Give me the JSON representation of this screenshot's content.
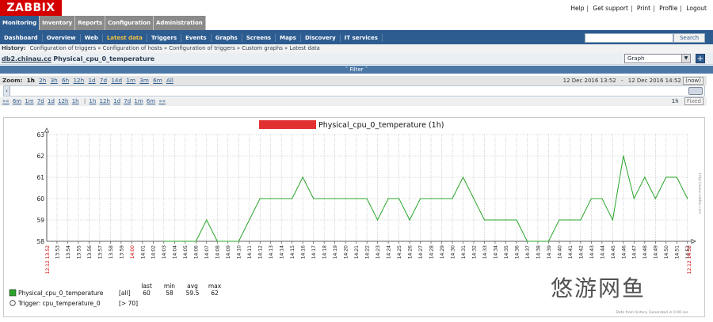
{
  "header": {
    "logo": "ZABBIX",
    "links": [
      "Help",
      "Get support",
      "Print",
      "Profile",
      "Logout"
    ]
  },
  "tabs": [
    {
      "label": "Monitoring",
      "active": true
    },
    {
      "label": "Inventory",
      "active": false
    },
    {
      "label": "Reports",
      "active": false
    },
    {
      "label": "Configuration",
      "active": false
    },
    {
      "label": "Administration",
      "active": false
    }
  ],
  "subnav": [
    {
      "label": "Dashboard",
      "active": false
    },
    {
      "label": "Overview",
      "active": false
    },
    {
      "label": "Web",
      "active": false
    },
    {
      "label": "Latest data",
      "active": true
    },
    {
      "label": "Triggers",
      "active": false
    },
    {
      "label": "Events",
      "active": false
    },
    {
      "label": "Graphs",
      "active": false
    },
    {
      "label": "Screens",
      "active": false
    },
    {
      "label": "Maps",
      "active": false
    },
    {
      "label": "Discovery",
      "active": false
    },
    {
      "label": "IT services",
      "active": false
    }
  ],
  "search": {
    "placeholder": "",
    "button": "Search"
  },
  "history": {
    "label": "History:",
    "items": [
      "Configuration of triggers",
      "Configuration of hosts",
      "Configuration of triggers",
      "Custom graphs",
      "Latest data"
    ]
  },
  "title": {
    "host": "db2.chinau.cc",
    "separator": ":",
    "graph": "Physical_cpu_0_temperature"
  },
  "graph_select": {
    "value": "Graph"
  },
  "filter": {
    "label": "ˇ Filter ˇ"
  },
  "zoom": {
    "label": "Zoom:",
    "options": [
      "1h",
      "2h",
      "3h",
      "6h",
      "12h",
      "1d",
      "7d",
      "14d",
      "1m",
      "3m",
      "6m",
      "All"
    ],
    "current": "1h",
    "from": "12 Dec 2016 13:52",
    "dash": "-",
    "to": "12 Dec 2016 14:52",
    "now": "(now)"
  },
  "nav": {
    "back": [
      "««",
      "6m",
      "1m",
      "7d",
      "1d",
      "12h",
      "1h"
    ],
    "forward": [
      "1h",
      "12h",
      "1d",
      "7d",
      "1m",
      "6m",
      "»»"
    ],
    "period": "1h",
    "fixed": "Fixed"
  },
  "graph_legend": {
    "item_name": "Physical_cpu_0_temperature",
    "item_func": "[all]",
    "cols": [
      "last",
      "min",
      "avg",
      "max"
    ],
    "vals": [
      "60",
      "58",
      "59.5",
      "62"
    ],
    "trigger_name": "Trigger: cpu_temperature_0",
    "trigger_cond": "[> 70]",
    "side_note": "Data from history. Generated in 0.00 sec",
    "vertical_note": "http://www.zabbix.com"
  },
  "chart_data": {
    "type": "line",
    "title": "Physical_cpu_0_temperature (1h)",
    "redacted_title_prefix": true,
    "ylim": [
      58,
      63
    ],
    "yticks": [
      "58",
      "59",
      "60",
      "61",
      "62",
      "63"
    ],
    "x_start_label": "12.12 13:52",
    "x_end_label": "12.12 14:52",
    "xticks": [
      "13:53",
      "13:54",
      "13:55",
      "13:56",
      "13:57",
      "13:58",
      "13:59",
      "14:00",
      "14:01",
      "14:02",
      "14:03",
      "14:04",
      "14:05",
      "14:06",
      "14:07",
      "14:08",
      "14:09",
      "14:10",
      "14:11",
      "14:12",
      "14:13",
      "14:14",
      "14:15",
      "14:16",
      "14:17",
      "14:18",
      "14:19",
      "14:20",
      "14:21",
      "14:22",
      "14:23",
      "14:24",
      "14:25",
      "14:26",
      "14:27",
      "14:28",
      "14:29",
      "14:30",
      "14:31",
      "14:32",
      "14:33",
      "14:34",
      "14:35",
      "14:36",
      "14:37",
      "14:38",
      "14:39",
      "14:40",
      "14:41",
      "14:42",
      "14:43",
      "14:44",
      "14:45",
      "14:46",
      "14:47",
      "14:48",
      "14:49",
      "14:50",
      "14:51",
      "14:52"
    ],
    "highlight_ticks": [
      "14:00"
    ],
    "series": [
      {
        "color": "#2aa52a",
        "x": [
          "14:03",
          "14:04",
          "14:05",
          "14:06",
          "14:07",
          "14:08",
          "14:09",
          "14:10",
          "14:11",
          "14:12",
          "14:13",
          "14:14",
          "14:15",
          "14:16",
          "14:17",
          "14:18",
          "14:19",
          "14:20",
          "14:21",
          "14:22",
          "14:23",
          "14:24",
          "14:25",
          "14:26",
          "14:27",
          "14:28",
          "14:29",
          "14:30",
          "14:31",
          "14:32",
          "14:33",
          "14:34",
          "14:35",
          "14:36",
          "14:37",
          "14:38",
          "14:39",
          "14:40",
          "14:41",
          "14:42",
          "14:43",
          "14:44",
          "14:45",
          "14:46",
          "14:47",
          "14:48",
          "14:49",
          "14:50",
          "14:51",
          "14:52"
        ],
        "values": [
          58,
          58,
          58,
          58,
          59,
          58,
          58,
          58,
          59,
          60,
          60,
          60,
          60,
          61,
          60,
          60,
          60,
          60,
          60,
          60,
          59,
          60,
          60,
          59,
          60,
          60,
          60,
          60,
          61,
          60,
          59,
          59,
          59,
          59,
          58,
          58,
          58,
          59,
          59,
          59,
          60,
          60,
          59,
          62,
          60,
          61,
          60,
          61,
          61,
          60
        ]
      }
    ],
    "grid": true,
    "line_color": "#2aa52a",
    "axis_color": "#333333",
    "highlight_color": "#cc0000"
  },
  "watermark": "悠游网鱼"
}
